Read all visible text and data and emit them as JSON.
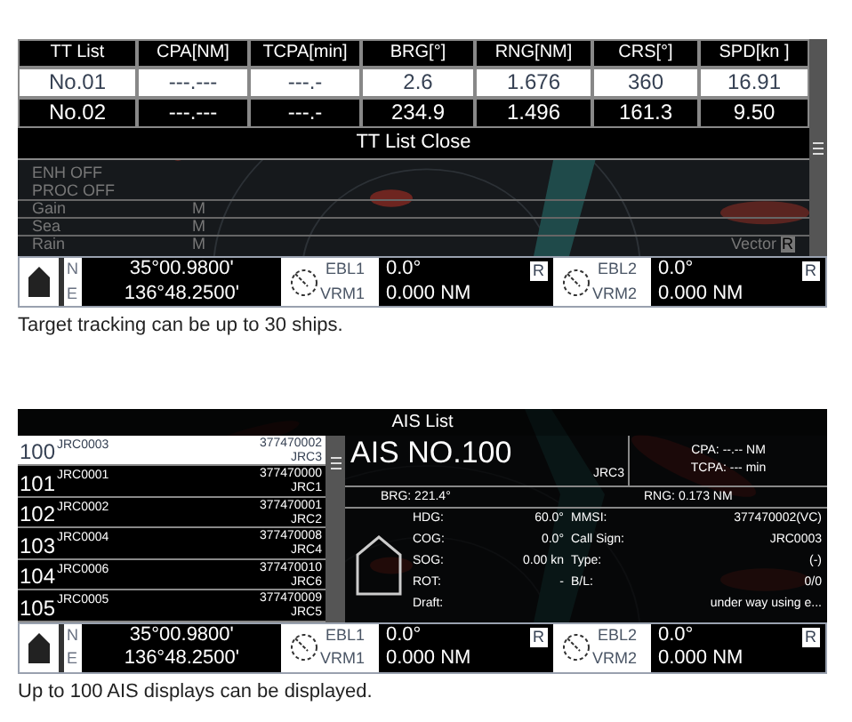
{
  "tt_panel": {
    "columns": [
      "TT List",
      "CPA[NM]",
      "TCPA[min]",
      "BRG[°]",
      "RNG[NM]",
      "CRS[°]",
      "SPD[kn ]"
    ],
    "rows": [
      {
        "cells": [
          "No.01",
          "---.---",
          "---.-",
          "2.6",
          "1.676",
          "360",
          "16.91"
        ],
        "selected": true
      },
      {
        "cells": [
          "No.02",
          "---.---",
          "---.-",
          "234.9",
          "1.496",
          "161.3",
          "9.50"
        ],
        "selected": false
      }
    ],
    "close_button": "TT List Close",
    "radar_labels": [
      {
        "label": "ENH OFF"
      },
      {
        "label": "PROC OFF"
      },
      {
        "label": "Gain",
        "mode": "M"
      },
      {
        "label": "Sea",
        "mode": "M"
      },
      {
        "label": "Rain",
        "mode": "M"
      }
    ],
    "vector": {
      "label": "Vector",
      "mode": "R"
    },
    "status_bar": {
      "lat_label": "N",
      "lat": "35°00.9800'",
      "lon_label": "E",
      "lon": "136°48.2500'",
      "lines": [
        {
          "ebl_label": "EBL1",
          "ebl": "0.0°",
          "mode": "R",
          "vrm_label": "VRM1",
          "vrm": "0.000 NM"
        },
        {
          "ebl_label": "EBL2",
          "ebl": "0.0°",
          "mode": "R",
          "vrm_label": "VRM2",
          "vrm": "0.000 NM"
        }
      ]
    }
  },
  "caption_1": "Target tracking can be up to 30 ships.",
  "ais_panel": {
    "title": "AIS List",
    "rows": [
      {
        "number": "100",
        "name": "JRC0003",
        "mmsi": "377470002",
        "call_sign": "JRC3",
        "selected": true
      },
      {
        "number": "101",
        "name": "JRC0001",
        "mmsi": "377470000",
        "call_sign": "JRC1",
        "selected": false
      },
      {
        "number": "102",
        "name": "JRC0002",
        "mmsi": "377470001",
        "call_sign": "JRC2",
        "selected": false
      },
      {
        "number": "103",
        "name": "JRC0004",
        "mmsi": "377470008",
        "call_sign": "JRC4",
        "selected": false
      },
      {
        "number": "104",
        "name": "JRC0006",
        "mmsi": "377470010",
        "call_sign": "JRC6",
        "selected": false
      },
      {
        "number": "105",
        "name": "JRC0005",
        "mmsi": "377470009",
        "call_sign": "JRC5",
        "selected": false
      }
    ],
    "detail": {
      "title": "AIS NO.100",
      "call_sign": "JRC3",
      "cpa": "CPA: --.-- NM",
      "tcpa": "TCPA: --- min",
      "brg": "BRG: 221.4°",
      "rng": "RNG: 0.173 NM",
      "left_fields": [
        {
          "label": "HDG:",
          "value": "60.0°"
        },
        {
          "label": "COG:",
          "value": "0.0°"
        },
        {
          "label": "SOG:",
          "value": "0.00 kn"
        },
        {
          "label": "ROT:",
          "value": "-"
        },
        {
          "label": "Draft:"
        }
      ],
      "right_fields": [
        {
          "label": "MMSI:",
          "value": "377470002(VC)"
        },
        {
          "label": "Call Sign:",
          "value": "JRC0003"
        },
        {
          "label": "Type:",
          "value": "(-)"
        },
        {
          "label": "B/L:",
          "value": "0/0"
        },
        {
          "value": "under way using e..."
        }
      ]
    },
    "status_bar": {
      "lat_label": "N",
      "lat": "35°00.9800'",
      "lon_label": "E",
      "lon": "136°48.2500'",
      "lines": [
        {
          "ebl_label": "EBL1",
          "ebl": "0.0°",
          "mode": "R",
          "vrm_label": "VRM1",
          "vrm": "0.000 NM"
        },
        {
          "ebl_label": "EBL2",
          "ebl": "0.0°",
          "mode": "R",
          "vrm_label": "VRM2",
          "vrm": "0.000 NM"
        }
      ]
    }
  },
  "caption_2": "Up to 100 AIS displays can be displayed."
}
